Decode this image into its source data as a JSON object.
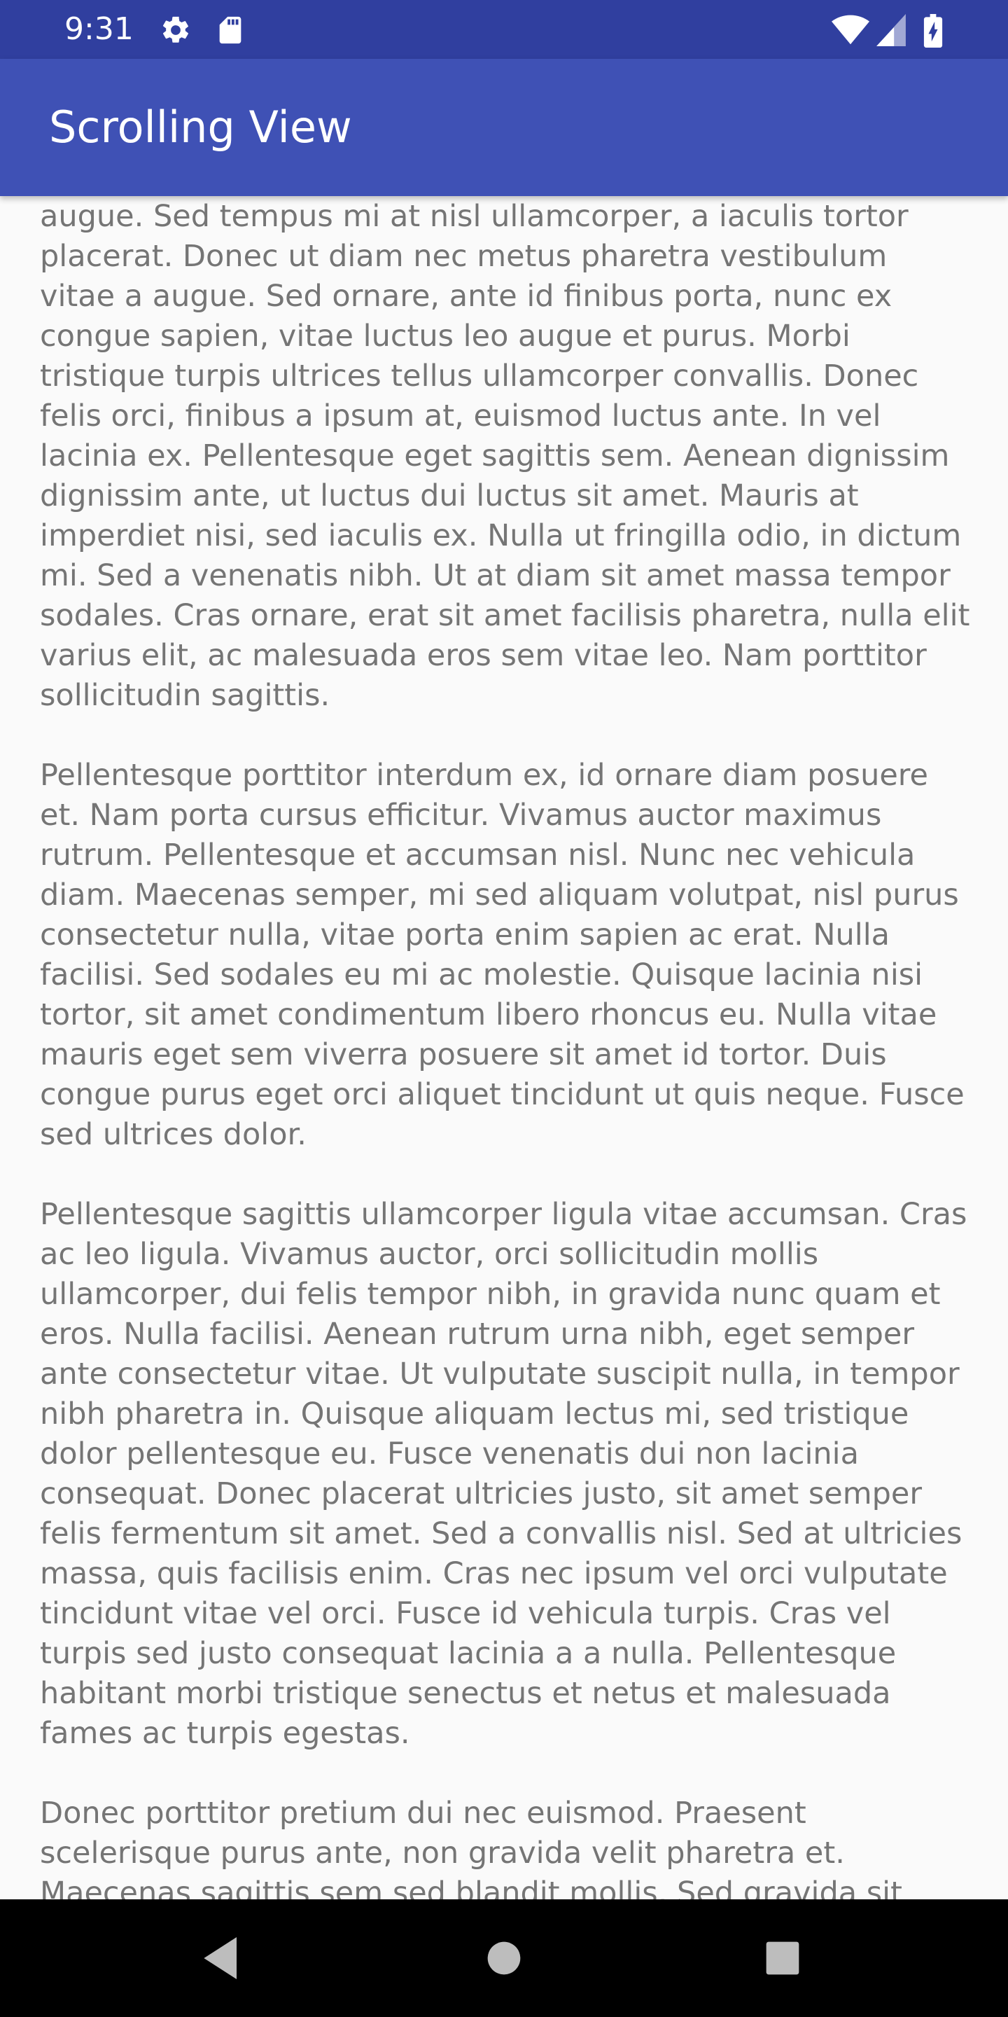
{
  "status_bar": {
    "time": "9:31",
    "icons_left": [
      "gear-icon",
      "sd-card-icon"
    ],
    "icons_right": [
      "wifi-icon",
      "signal-icon",
      "battery-charging-icon"
    ]
  },
  "app_bar": {
    "title": "Scrolling View",
    "color": "#3f51b5",
    "status_color": "#303f9f"
  },
  "content": {
    "paragraphs": [
      "Sed purus metus, scelerisque et leo vitae, mollis pulvinar augue. Sed tempus mi at nisl ullamcorper, a iaculis tortor placerat. Donec ut diam nec metus pharetra vestibulum vitae a augue. Sed ornare, ante id finibus porta, nunc ex congue sapien, vitae luctus leo augue et purus. Morbi tristique turpis ultrices tellus ullamcorper convallis. Donec felis orci, finibus a ipsum at, euismod luctus ante. In vel lacinia ex. Pellentesque eget sagittis sem. Aenean dignissim dignissim ante, ut luctus dui luctus sit amet. Mauris at imperdiet nisi, sed iaculis ex. Nulla ut fringilla odio, in dictum mi. Sed a venenatis nibh. Ut at diam sit amet massa tempor sodales. Cras ornare, erat sit amet facilisis pharetra, nulla elit varius elit, ac malesuada eros sem vitae leo. Nam porttitor sollicitudin sagittis.",
      "Pellentesque porttitor interdum ex, id ornare diam posuere et. Nam porta cursus efficitur. Vivamus auctor maximus rutrum. Pellentesque et accumsan nisl. Nunc nec vehicula diam. Maecenas semper, mi sed aliquam volutpat, nisl purus consectetur nulla, vitae porta enim sapien ac erat. Nulla facilisi. Sed sodales eu mi ac molestie. Quisque lacinia nisi tortor, sit amet condimentum libero rhoncus eu. Nulla vitae mauris eget sem viverra posuere sit amet id tortor. Duis congue purus eget orci aliquet tincidunt ut quis neque. Fusce sed ultrices dolor.",
      "Pellentesque sagittis ullamcorper ligula vitae accumsan. Cras ac leo ligula. Vivamus auctor, orci sollicitudin mollis ullamcorper, dui felis tempor nibh, in gravida nunc quam et eros. Nulla facilisi. Aenean rutrum urna nibh, eget semper ante consectetur vitae. Ut vulputate suscipit nulla, in tempor nibh pharetra in. Quisque aliquam lectus mi, sed tristique dolor pellentesque eu. Fusce venenatis dui non lacinia consequat. Donec placerat ultricies justo, sit amet semper felis fermentum sit amet. Sed a convallis nisl. Sed at ultricies massa, quis facilisis enim. Cras nec ipsum vel orci vulputate tincidunt vitae vel orci. Fusce id vehicula turpis. Cras vel turpis sed justo consequat lacinia a a nulla. Pellentesque habitant morbi tristique senectus et netus et malesuada fames ac turpis egestas.",
      "Donec porttitor pretium dui nec euismod. Praesent scelerisque purus ante, non gravida velit pharetra et. Maecenas sagittis sem sed blandit mollis. Sed gravida sit amet nisl nec congue. Donec interdum scelerisque arcu sed interdum. Sed aliquam posuere euismod. Aenean lacus eros, aliquam eget maximus quis, elementum at erat. Morbi a elit nunc. Fusce mattis commodo nulla sed sollicitudin."
    ]
  },
  "nav_bar": {
    "buttons": [
      "back-icon",
      "home-icon",
      "recents-icon"
    ]
  }
}
